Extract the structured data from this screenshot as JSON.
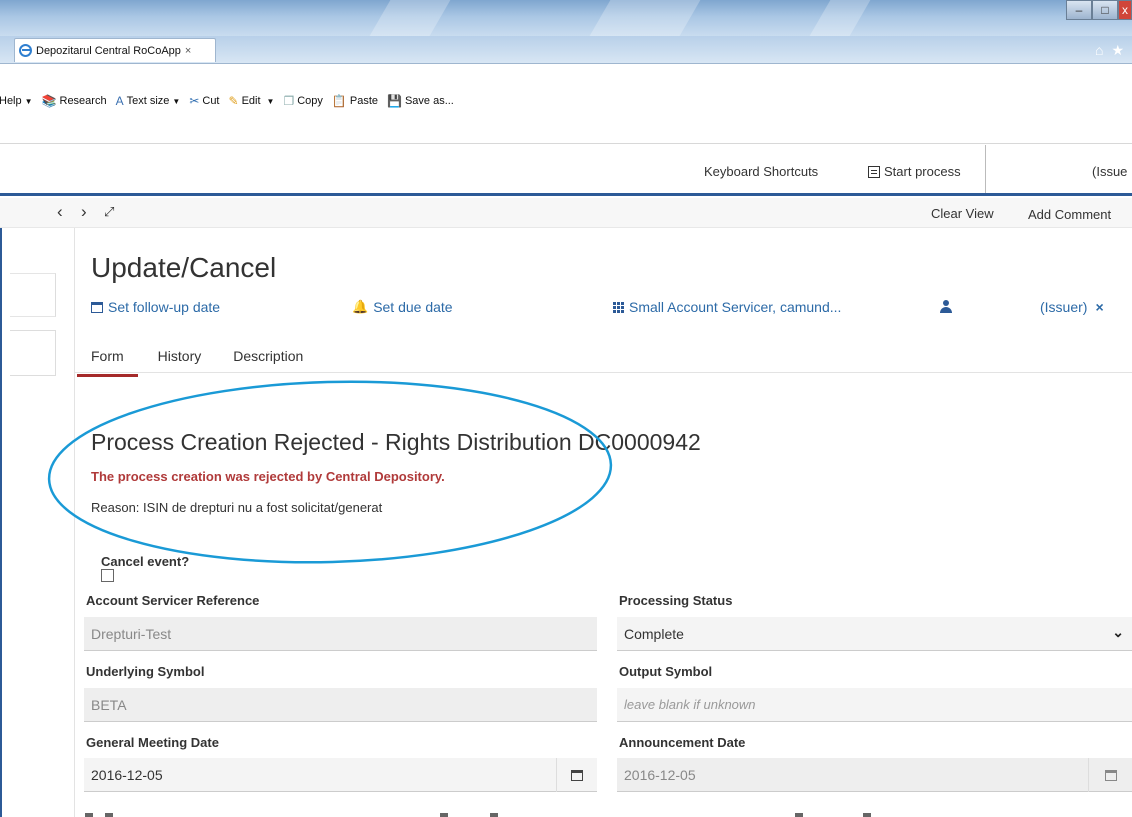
{
  "browser": {
    "tab_title": "Depozitarul Central RoCoApp",
    "tab_close": "×",
    "nav_icons": [
      "home-icon",
      "favorites-star-icon"
    ],
    "window_buttons": {
      "minimize": "–",
      "maximize": "□",
      "close": "x"
    }
  },
  "command_bar": {
    "help": "Help",
    "research": "Research",
    "text_size": "Text size",
    "cut": "Cut",
    "edit": "Edit",
    "copy": "Copy",
    "paste": "Paste",
    "save_as": "Save as..."
  },
  "app_header": {
    "keyboard_shortcuts": "Keyboard Shortcuts",
    "start_process": "Start process",
    "issuer": "(Issue"
  },
  "view_toolbar": {
    "clear_view": "Clear View",
    "add_comment": "Add Comment"
  },
  "task": {
    "title": "Update/Cancel",
    "follow_up": "Set follow-up date",
    "due_date": "Set due date",
    "groups": "Small Account Servicer, camund...",
    "assignee": "(Issuer)",
    "assignee_remove": "×",
    "tabs": [
      "Form",
      "History",
      "Description"
    ]
  },
  "form": {
    "title": "Process Creation Rejected - Rights Distribution DC0000942",
    "rejection_message": "The process creation was rejected by Central Depository.",
    "reason": "Reason: ISIN de drepturi nu a fost solicitat/generat",
    "cancel_event_label": "Cancel event?",
    "cancel_event_checked": false,
    "fields": {
      "account_servicer_reference": {
        "label": "Account Servicer Reference",
        "value": "Drepturi-Test"
      },
      "processing_status": {
        "label": "Processing Status",
        "value": "Complete"
      },
      "underlying_symbol": {
        "label": "Underlying Symbol",
        "value": "BETA"
      },
      "output_symbol": {
        "label": "Output Symbol",
        "placeholder": "leave blank if unknown"
      },
      "general_meeting_date": {
        "label": "General Meeting Date",
        "value": "2016-12-05"
      },
      "announcement_date": {
        "label": "Announcement Date",
        "value": "2016-12-05"
      }
    }
  },
  "colors": {
    "accent_blue": "#2c5a97",
    "link_blue": "#2c6aa7",
    "error_red": "#b03a3a",
    "active_tab": "#a52a2a",
    "annotation_oval": "#1a9ad6"
  }
}
